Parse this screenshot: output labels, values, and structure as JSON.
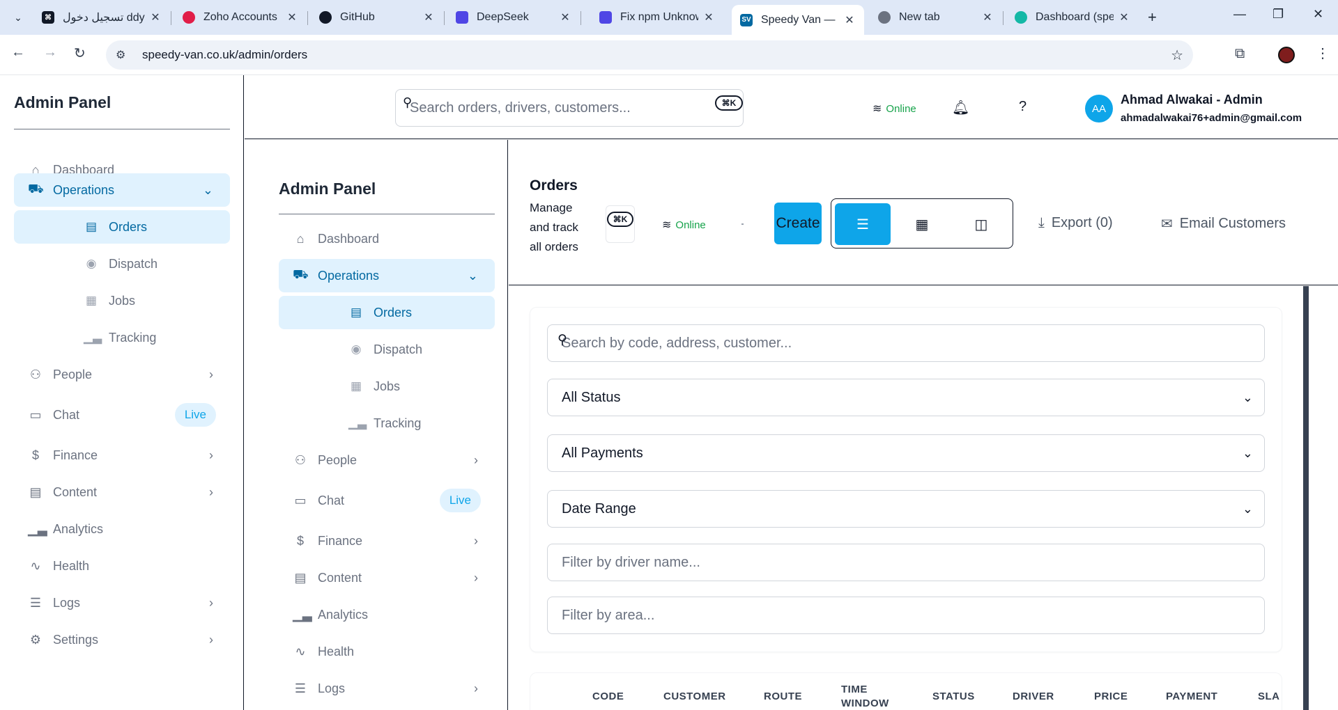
{
  "browser": {
    "tabs": [
      {
        "title": "تسجيل دخول ddy",
        "close": "✕",
        "favicon_color": "#111827"
      },
      {
        "title": "Zoho Accounts",
        "close": "✕",
        "favicon_color": "#e11d48"
      },
      {
        "title": "GitHub",
        "close": "✕",
        "favicon_color": "#111827"
      },
      {
        "title": "DeepSeek",
        "close": "✕",
        "favicon_color": "#4f46e5"
      },
      {
        "title": "Fix npm Unknow",
        "close": "✕",
        "favicon_color": "#4f46e5"
      },
      {
        "title": "Speedy Van — P",
        "close": "✕",
        "favicon_color": "#0369a1",
        "favicon_text": "SV"
      },
      {
        "title": "New tab",
        "close": "✕",
        "favicon_color": "#6b7280"
      },
      {
        "title": "Dashboard (spee",
        "close": "✕",
        "favicon_color": "#14b8a6"
      }
    ],
    "url": "speedy-van.co.uk/admin/orders"
  },
  "sidebar": {
    "title": "Admin Panel",
    "items": [
      {
        "label": "Dashboard",
        "icon": "home-icon"
      },
      {
        "label": "Operations",
        "icon": "truck-icon"
      },
      {
        "label": "Orders",
        "icon": "document-icon"
      },
      {
        "label": "Dispatch",
        "icon": "map-pin-icon"
      },
      {
        "label": "Jobs",
        "icon": "calendar-icon"
      },
      {
        "label": "Tracking",
        "icon": "bar-chart-icon"
      },
      {
        "label": "People",
        "icon": "users-icon"
      },
      {
        "label": "Chat",
        "icon": "chat-icon",
        "badge": "Live"
      },
      {
        "label": "Finance",
        "icon": "dollar-icon"
      },
      {
        "label": "Content",
        "icon": "document-icon"
      },
      {
        "label": "Analytics",
        "icon": "bar-chart-icon"
      },
      {
        "label": "Health",
        "icon": "activity-icon"
      },
      {
        "label": "Logs",
        "icon": "database-icon"
      },
      {
        "label": "Settings",
        "icon": "gear-icon"
      }
    ]
  },
  "header": {
    "search_placeholder": "Search orders, drivers, customers...",
    "shortcut": "⌘K",
    "status": "Online",
    "avatar_initials": "AA",
    "user_name": "Ahmad Alwakai - Admin",
    "user_email": "ahmadalwakai76+admin@gmail.com"
  },
  "orders": {
    "title": "Orders",
    "subtitle": "Manage and track all orders",
    "shortcut": "⌘K",
    "status": "Online",
    "create_label": "Create",
    "export_label": "Export (0)",
    "email_label": "Email Customers"
  },
  "filters": {
    "search_placeholder": "Search by code, address, customer...",
    "status_value": "All Status",
    "payment_value": "All Payments",
    "date_value": "Date Range",
    "driver_placeholder": "Filter by driver name...",
    "area_placeholder": "Filter by area..."
  },
  "table": {
    "columns": [
      "CODE",
      "CUSTOMER",
      "ROUTE",
      "TIME WINDOW",
      "STATUS",
      "DRIVER",
      "PRICE",
      "PAYMENT",
      "SLA"
    ]
  },
  "colors": {
    "accent": "#0ea5e9",
    "active_bg": "#e0f2fe",
    "active_text": "#0369a1",
    "online": "#16a34a"
  }
}
